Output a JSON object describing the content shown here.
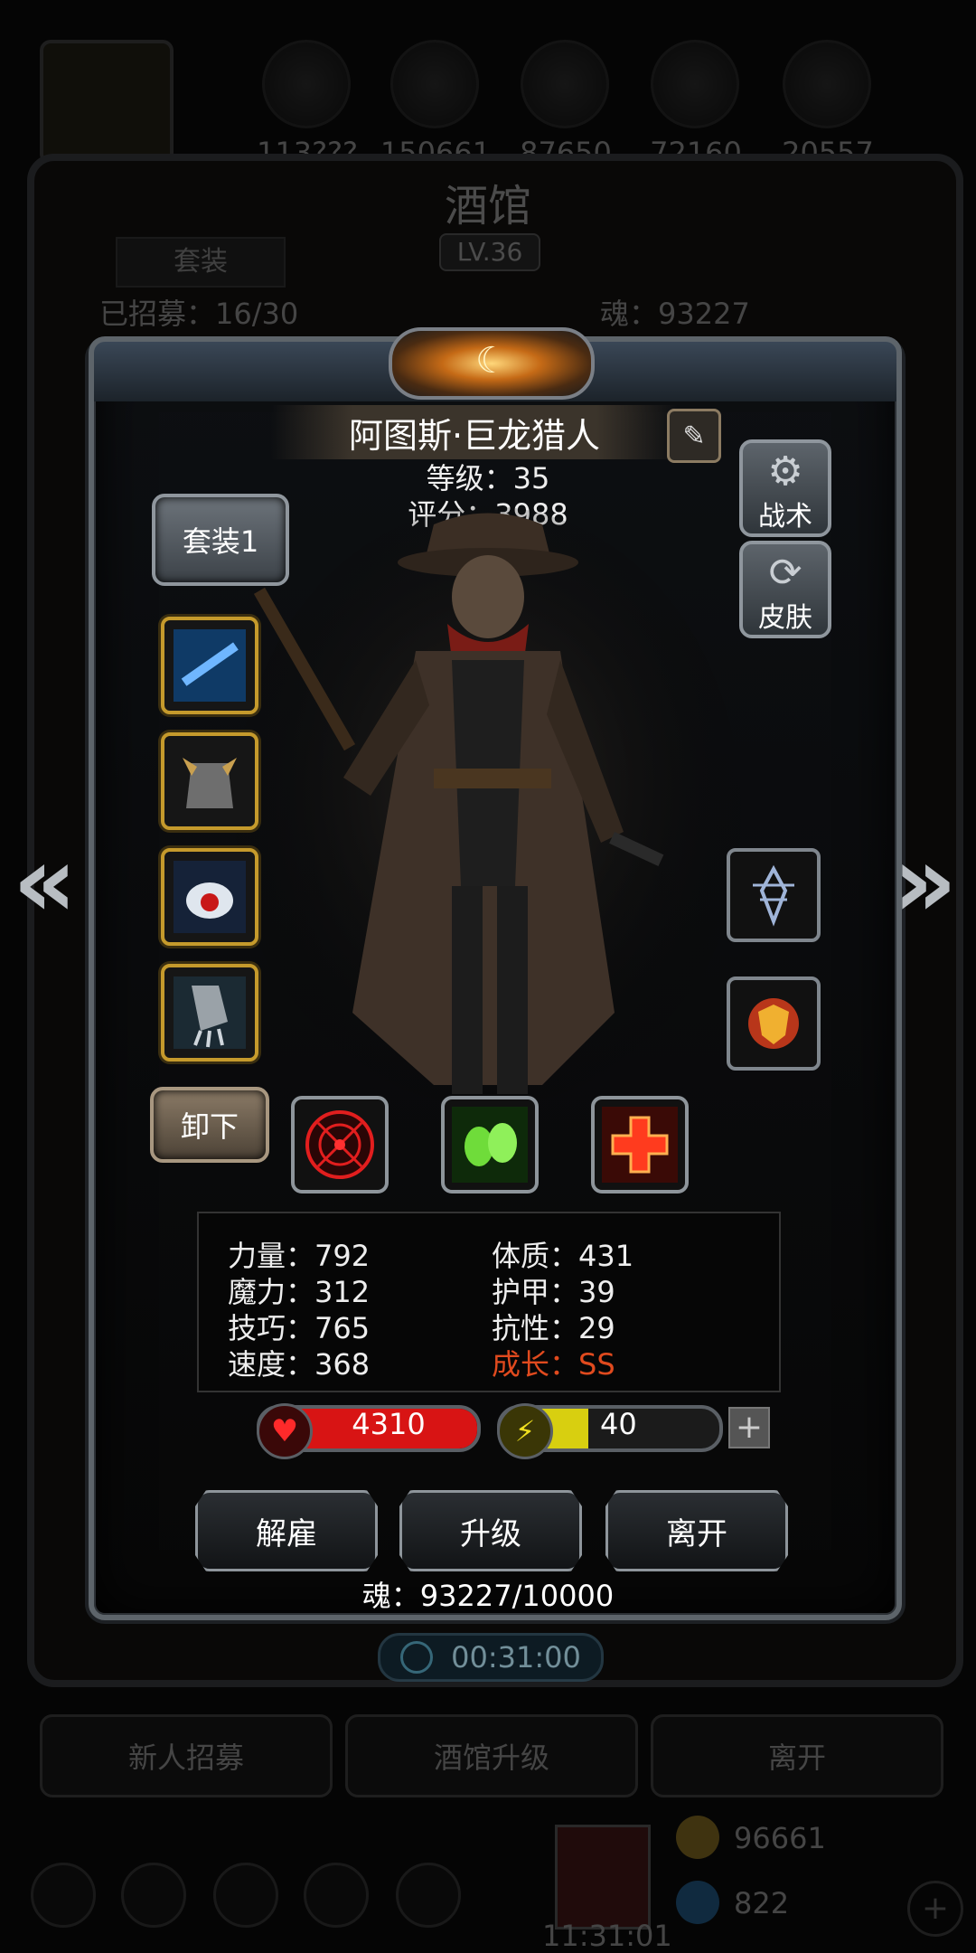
{
  "background": {
    "resources": [
      "113???",
      "150661",
      "87650",
      "72160",
      "20557"
    ],
    "title": "酒馆",
    "level": "LV.36",
    "set_tab": "套装",
    "recruit_count": "已招募：16/30",
    "soul_count": "魂：93227",
    "timer": "00:31:00",
    "bottom_buttons": [
      "新人招募",
      "酒馆升级",
      "离开"
    ],
    "gold": "96661",
    "gems": "822",
    "clock": "11:31:01"
  },
  "hero": {
    "name": "阿图斯·巨龙猎人",
    "level": "等级：35",
    "score": "评分：3988",
    "set_button": "套装1",
    "tactics_button": "战术",
    "skin_button": "皮肤",
    "unequip_button": "卸下"
  },
  "equipment": [
    {
      "slot": "weapon",
      "icon": "rifle-icon"
    },
    {
      "slot": "armor",
      "icon": "armor-icon"
    },
    {
      "slot": "amulet",
      "icon": "amulet-icon"
    },
    {
      "slot": "gloves",
      "icon": "claw-glove-icon"
    }
  ],
  "right_items": [
    {
      "icon": "sigil-icon"
    },
    {
      "icon": "shield-emblem-icon"
    }
  ],
  "skills": [
    {
      "icon": "target-icon",
      "color": "#e11e1e"
    },
    {
      "icon": "poison-skull-icon",
      "color": "#6fdc3a"
    },
    {
      "icon": "heal-cross-icon",
      "color": "#ff3b1e"
    }
  ],
  "stats": {
    "strength": "力量：792",
    "magic": "魔力：312",
    "skill": "技巧：765",
    "speed": "速度：368",
    "constitution": "体质：431",
    "armor": "护甲：39",
    "resistance": "抗性：29",
    "growth": "成长：SS"
  },
  "hp": {
    "value": "4310",
    "fill_ratio": 1.0,
    "color": "#d81414"
  },
  "energy": {
    "value": "40",
    "fill_ratio": 0.4,
    "color": "#d8cf10"
  },
  "actions": {
    "dismiss": "解雇",
    "upgrade": "升级",
    "leave": "离开"
  },
  "soul_progress": "魂：93227/10000",
  "colors": {
    "growth_text": "#e04a1e",
    "slot_border": "#c59a2c"
  }
}
